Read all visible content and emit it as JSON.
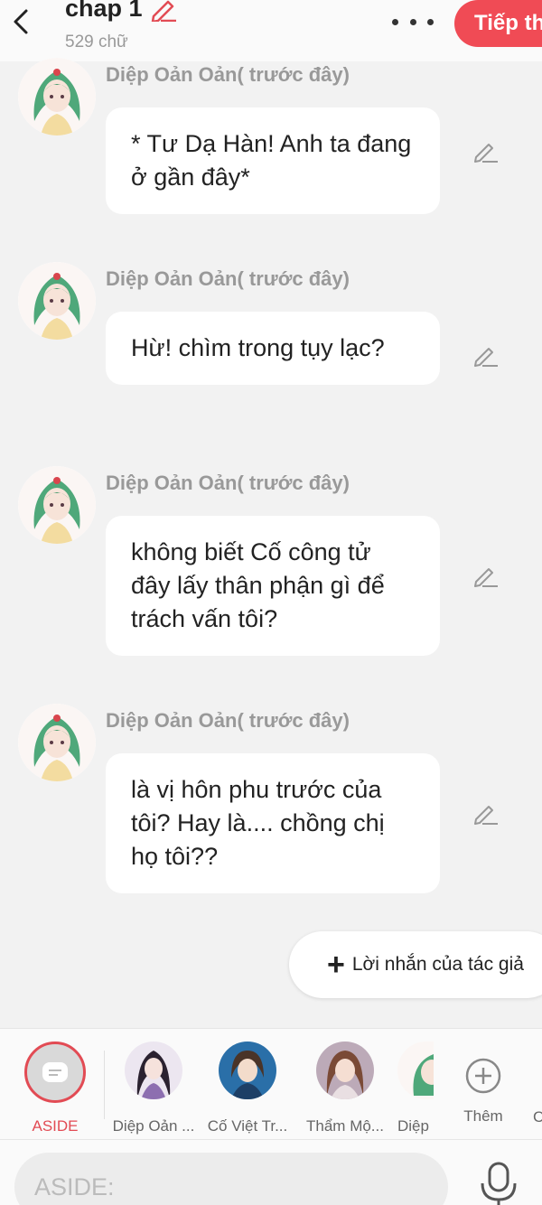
{
  "header": {
    "title": "chap 1",
    "word_count": "529 chữ",
    "continue_label": "Tiếp th"
  },
  "messages": [
    {
      "sender": "Diệp Oản Oản( trước đây)",
      "text": "* Tư Dạ Hàn! Anh ta đang ở gần đây*"
    },
    {
      "sender": "Diệp Oản Oản( trước đây)",
      "text": "Hừ! chìm trong tụy lạc?"
    },
    {
      "sender": "Diệp Oản Oản( trước đây)",
      "text": "không biết Cố công tử đây lấy thân phận gì để trách vấn tôi?"
    },
    {
      "sender": "Diệp Oản Oản( trước đây)",
      "text": "là vị hôn phu trước của tôi? Hay là.... chồng chị họ tôi??"
    }
  ],
  "author_note": {
    "label": "Lời nhắn của tác giả"
  },
  "characters": [
    {
      "name": "ASIDE"
    },
    {
      "name": "Diệp Oản ..."
    },
    {
      "name": "Cố Việt Tr..."
    },
    {
      "name": "Thẩm Mộ..."
    },
    {
      "name": "Diệp"
    },
    {
      "name": "Thêm"
    },
    {
      "name": "C"
    }
  ],
  "input": {
    "placeholder": "ASIDE:"
  },
  "colors": {
    "accent": "#f04b55",
    "bubble": "#ffffff",
    "background": "#f2f2f2"
  }
}
